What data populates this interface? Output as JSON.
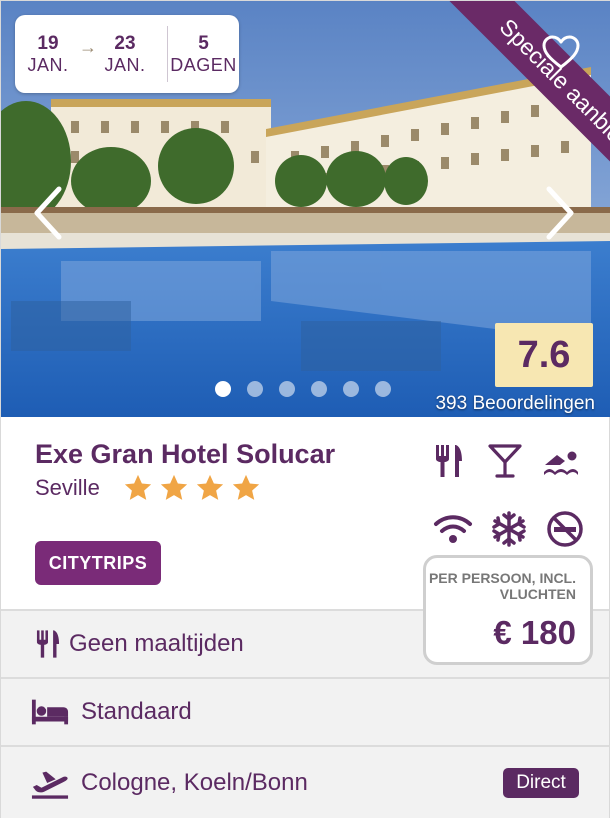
{
  "dates": {
    "from_day": "19",
    "from_month": "JAN.",
    "to_day": "23",
    "to_month": "JAN.",
    "arrow": "→",
    "days_count": "5",
    "days_label": "DAGEN"
  },
  "promo_ribbon": "Speciale aanbieding",
  "favorite_icon": "heart-outline-icon",
  "carousel": {
    "prev_icon": "chevron-left-icon",
    "next_icon": "chevron-right-icon",
    "slide_count": 6,
    "active_slide": 1
  },
  "rating": {
    "score": "7.6",
    "reviews": "393 Beoordelingen"
  },
  "hotel": {
    "name": "Exe Gran Hotel Solucar",
    "city": "Seville",
    "stars": 4
  },
  "category_badge": "CITYTRIPS",
  "amenities": [
    "restaurant-icon",
    "bar-cocktail-icon",
    "swimming-icon",
    "wifi-icon",
    "air-conditioning-icon",
    "no-smoking-icon"
  ],
  "price": {
    "note": "PER PERSOON, INCL. VLUCHTEN",
    "value": "€ 180"
  },
  "details": {
    "meals": {
      "icon": "cutlery-icon",
      "label": "Geen maaltijden"
    },
    "room": {
      "icon": "bed-icon",
      "label": "Standaard"
    },
    "flight": {
      "icon": "airplane-departure-icon",
      "label": "Cologne, Koeln/Bonn",
      "badge": "Direct"
    }
  },
  "colors": {
    "brand_purple": "#5b2a62",
    "badge_purple": "#7a2b78",
    "ribbon_purple": "#6a2a67",
    "rating_bg": "#f7e7b2",
    "star_orange": "#f0a545",
    "row_bg": "#f2f2f2"
  }
}
